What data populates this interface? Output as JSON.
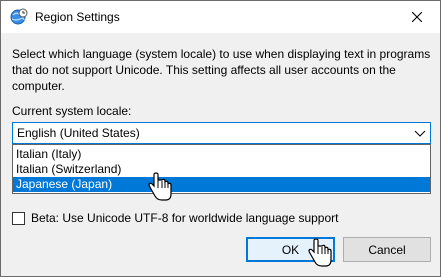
{
  "window": {
    "title": "Region Settings",
    "icon": "globe-clock-icon",
    "close": "close-icon"
  },
  "description": "Select which language (system locale) to use when displaying text in programs that do not support Unicode. This setting affects all user accounts on the computer.",
  "locale": {
    "label": "Current system locale:",
    "selected_value": "English (United States)",
    "options_visible": [
      "Italian (Italy)",
      "Italian (Switzerland)",
      "Japanese (Japan)"
    ],
    "highlighted_option": "Japanese (Japan)"
  },
  "beta": {
    "label": "Beta: Use Unicode UTF-8 for worldwide language support",
    "checked": false
  },
  "buttons": {
    "ok": "OK",
    "cancel": "Cancel"
  },
  "colors": {
    "accent": "#0078d7",
    "dialog_bg": "#f0f0f0"
  }
}
